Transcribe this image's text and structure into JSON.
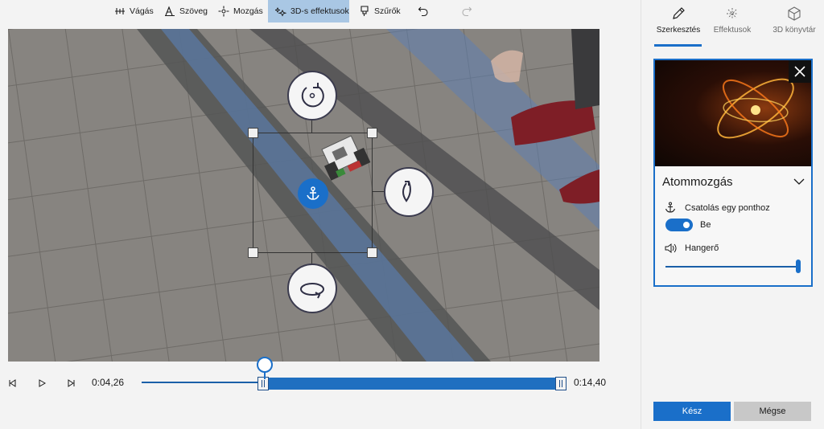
{
  "toolbar": {
    "items": [
      {
        "label": "Vágás",
        "icon": "trim-icon"
      },
      {
        "label": "Szöveg",
        "icon": "text-icon"
      },
      {
        "label": "Mozgás",
        "icon": "motion-icon"
      },
      {
        "label": "3D-s effektusok",
        "icon": "3d-effects-icon",
        "active": true
      },
      {
        "label": "Szűrők",
        "icon": "filters-icon"
      }
    ],
    "undo_icon": "undo-icon",
    "redo_icon": "redo-icon"
  },
  "playback": {
    "current_time": "0:04,26",
    "end_time": "0:14,40"
  },
  "panel": {
    "tabs": [
      {
        "label": "Szerkesztés",
        "icon": "pencil-icon",
        "active": true
      },
      {
        "label": "Effektusok",
        "icon": "sparkle-icon"
      },
      {
        "label": "3D könyvtár",
        "icon": "cube-icon"
      }
    ],
    "effect": {
      "title": "Atommozgás",
      "attach_label": "Csatolás egy ponthoz",
      "toggle_state": "Be",
      "toggle_on": true,
      "volume_label": "Hangerő",
      "volume_level": 1.0
    },
    "done_label": "Kész",
    "cancel_label": "Mégse"
  },
  "colors": {
    "accent": "#1a6fc9",
    "active_tab_bg": "#a9c7e4"
  }
}
